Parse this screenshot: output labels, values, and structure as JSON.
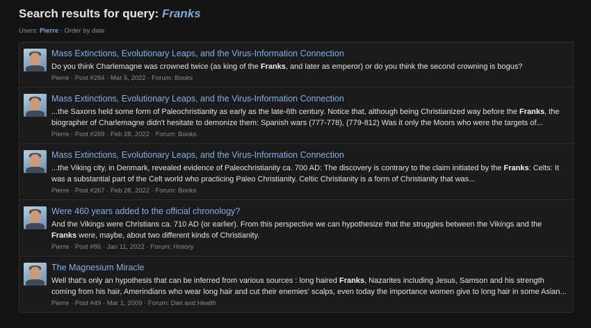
{
  "header": {
    "title_prefix": "Search results for query: ",
    "query": "Franks",
    "users_label": "Users: ",
    "user": "Pierre",
    "order": " · Order by date"
  },
  "results": [
    {
      "title": "Mass Extinctions, Evolutionary Leaps, and the Virus-Information Connection",
      "excerpt": [
        {
          "t": "Do you think Charlemagne was crowned twice (as king of the "
        },
        {
          "t": "Franks",
          "b": true
        },
        {
          "t": ", and later as emperor) or do you think the second crowning is bogus?"
        }
      ],
      "info": "Pierre · Post #284 · Mar 5, 2022 · Forum: Books"
    },
    {
      "title": "Mass Extinctions, Evolutionary Leaps, and the Virus-Information Connection",
      "excerpt": [
        {
          "t": "...the Saxons held some form of Paleochristianity as early as the late-6th century. Notice that, although being Christianized way before the "
        },
        {
          "t": "Franks",
          "b": true
        },
        {
          "t": ", the biographer of Charlemagne didn't hesitate to demonize them: Spanish wars (777-778), (779-812) Was it only the Moors who were the targets of..."
        }
      ],
      "info": "Pierre · Post #269 · Feb 28, 2022 · Forum: Books"
    },
    {
      "title": "Mass Extinctions, Evolutionary Leaps, and the Virus-Information Connection",
      "excerpt": [
        {
          "t": "...the Viking city, in Denmark, revealed evidence of Paleochristianity ca. 700 AD: The discovery is contrary to the claim initiated by the "
        },
        {
          "t": "Franks",
          "b": true
        },
        {
          "t": ": Celts: It was a substantial part of the Celt world who practicing Paleo Christianity. Celtic Christianity is a form of Christianity that was..."
        }
      ],
      "info": "Pierre · Post #267 · Feb 28, 2022 · Forum: Books"
    },
    {
      "title": "Were 460 years added to the official chronology?",
      "excerpt": [
        {
          "t": "And the Vikings were Christians ca. 710 AD (or earlier). From this perspective we can hypothesize that the struggles between the Vikings and the "
        },
        {
          "t": "Franks",
          "b": true
        },
        {
          "t": " were, maybe, about two different kinds of Christianity."
        }
      ],
      "info": "Pierre · Post #86 · Jan 11, 2022 · Forum: History"
    },
    {
      "title": "The Magnesium Miracle",
      "excerpt": [
        {
          "t": "Well that's only an hypothesis that can be inferred from various sources : long haired "
        },
        {
          "t": "Franks",
          "b": true
        },
        {
          "t": ", Nazarites including Jesus, Samson and his strength coming from his hair, Amerindians who wear long hair and cut their enemies' scalps, even today the importance women give to long hair in some Asian..."
        }
      ],
      "info": "Pierre · Post #49 · Mar 1, 2009 · Forum: Diet and Health"
    }
  ]
}
